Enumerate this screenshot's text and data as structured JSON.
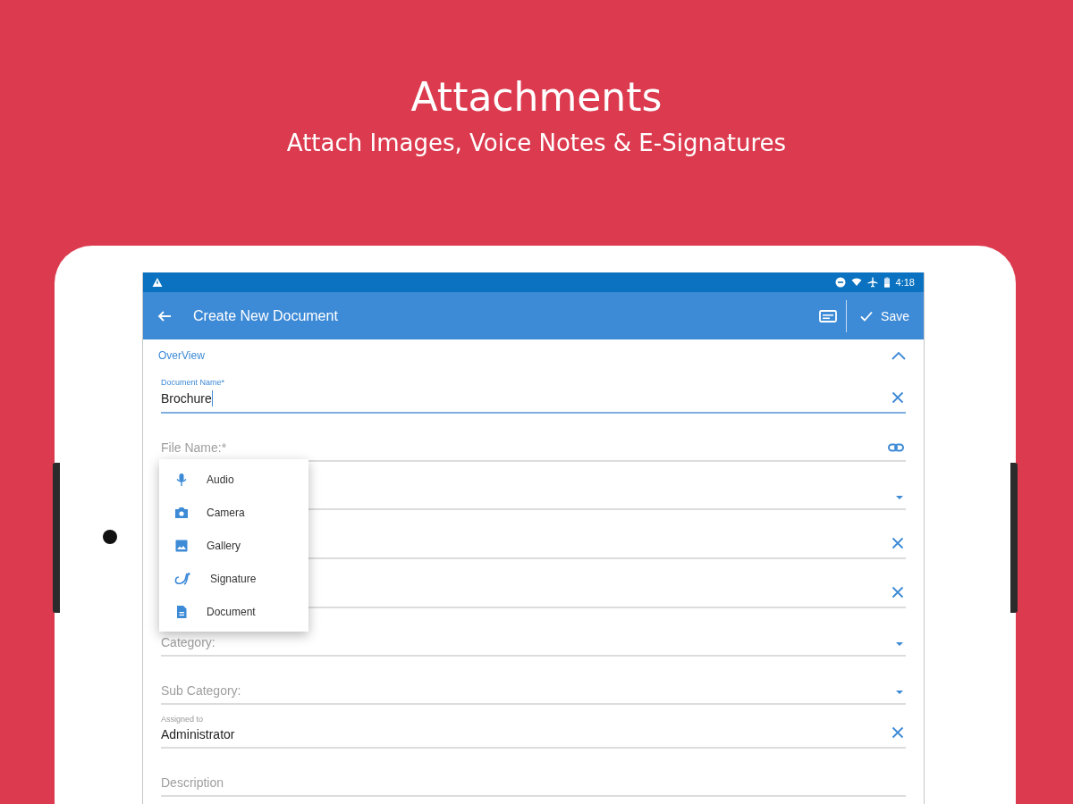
{
  "headline": {
    "title": "Attachments",
    "subtitle": "Attach Images, Voice Notes & E-Signatures"
  },
  "status_bar": {
    "time": "4:18"
  },
  "app_bar": {
    "title": "Create New Document",
    "save": "Save"
  },
  "section": {
    "title": "OverView",
    "expanded": true
  },
  "fields": [
    {
      "kind": "filled",
      "label": "Document Name*",
      "value": "Brochure",
      "focused": true,
      "clearable": true
    },
    {
      "kind": "link",
      "placeholder": "File Name:*"
    },
    {
      "kind": "select"
    },
    {
      "kind": "empty",
      "clearable": true
    },
    {
      "kind": "empty",
      "clearable": true
    },
    {
      "kind": "select",
      "placeholder": "Category:"
    },
    {
      "kind": "select",
      "placeholder": "Sub Category:"
    },
    {
      "kind": "filled",
      "label": "Assigned to",
      "value": "Administrator",
      "focused": false,
      "clearable": true
    },
    {
      "kind": "empty",
      "placeholder": "Description",
      "clearable": false
    }
  ],
  "attach_menu": [
    {
      "label": "Audio"
    },
    {
      "label": "Camera"
    },
    {
      "label": "Gallery"
    },
    {
      "label": "Signature"
    },
    {
      "label": "Document"
    }
  ]
}
